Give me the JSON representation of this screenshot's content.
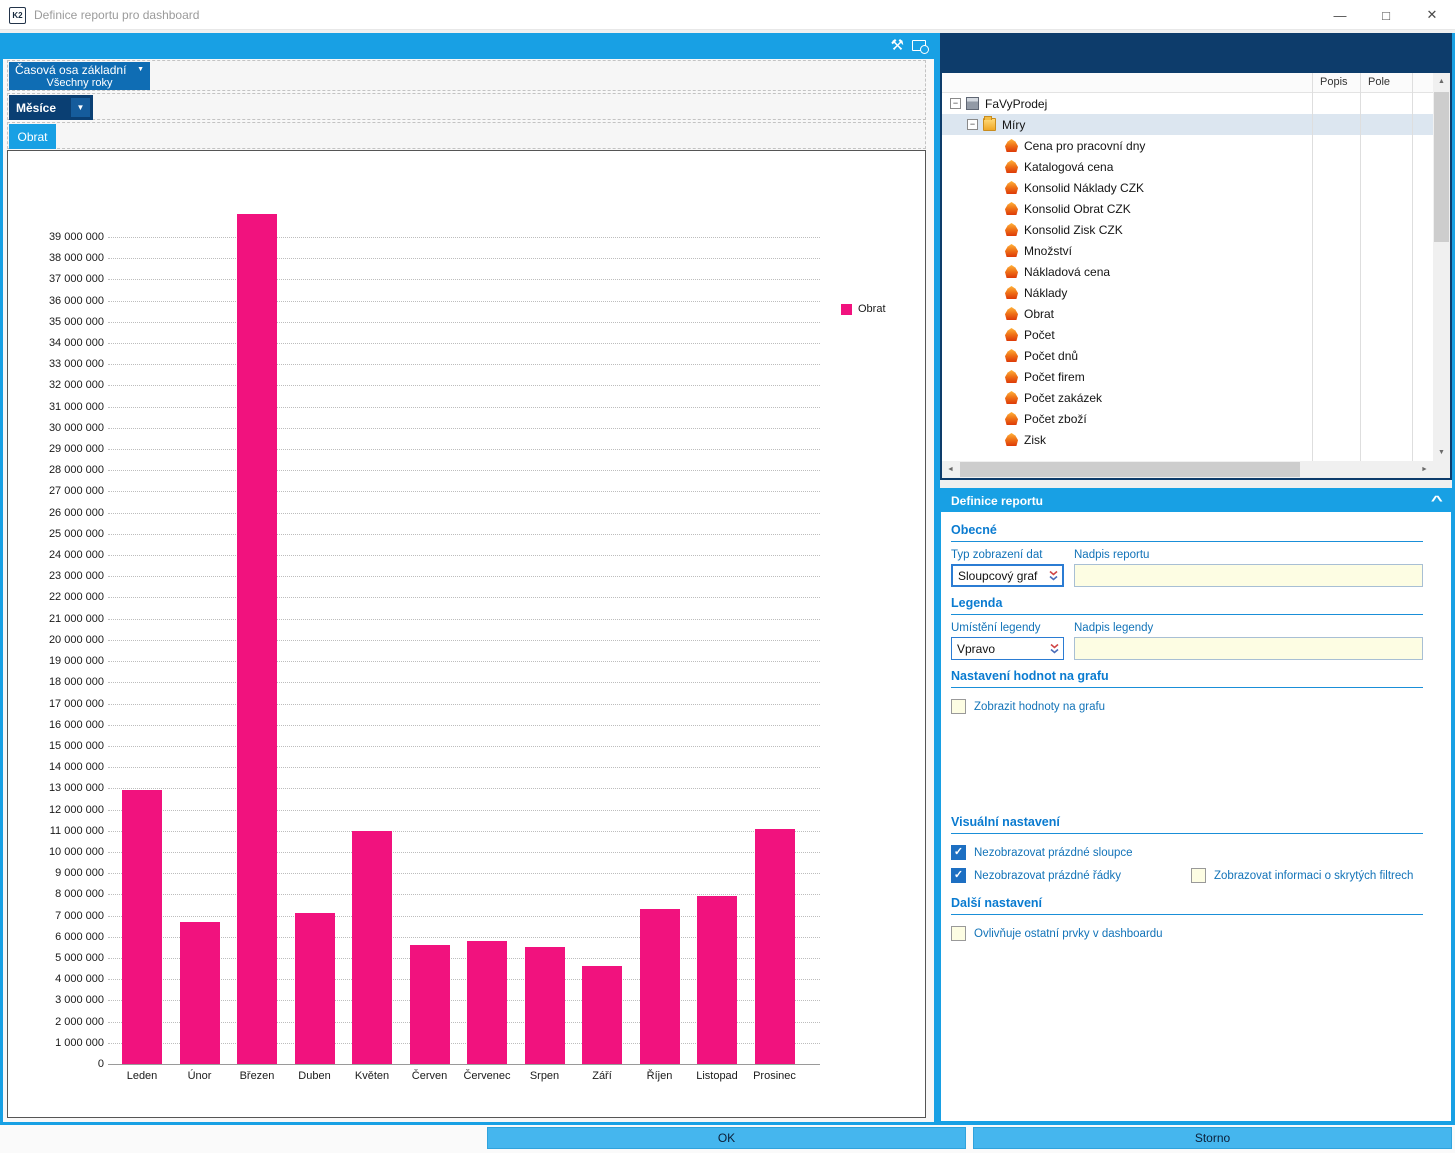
{
  "window": {
    "title": "Definice reportu pro dashboard",
    "app_icon": "K2"
  },
  "icons": {
    "minimize": "—",
    "maximize": "□",
    "close": "✕",
    "customize": "⚒",
    "triangle_down": "▼",
    "chevron_up": "^",
    "scroll_up": "▲",
    "scroll_down": "▼",
    "scroll_left": "◄",
    "scroll_right": "►",
    "check": "✓",
    "collapse_minus": "−"
  },
  "left_panel": {
    "time_axis_button": "Časová osa základní",
    "time_axis_value": "Všechny roky",
    "axis_button": "Měsíce",
    "measure_tab": "Obrat"
  },
  "chart_data": {
    "type": "bar",
    "title": "",
    "categories": [
      "Leden",
      "Únor",
      "Březen",
      "Duben",
      "Květen",
      "Červen",
      "Červenec",
      "Srpen",
      "Září",
      "Říjen",
      "Listopad",
      "Prosinec"
    ],
    "series": [
      {
        "name": "Obrat",
        "color": "#f1127e",
        "values": [
          12900000,
          6700000,
          40100000,
          7100000,
          11000000,
          5600000,
          5800000,
          5500000,
          4600000,
          7300000,
          7900000,
          11100000
        ]
      }
    ],
    "ylim": [
      0,
      39000000
    ],
    "y_tick_step": 1000000,
    "legend_position": "right",
    "grid": "horizontal-dotted"
  },
  "tree_panel": {
    "columns": {
      "popis": "Popis",
      "pole": "Pole"
    },
    "root": "FaVyProdej",
    "group": "Míry",
    "selected": "Míry",
    "items": [
      "Cena pro pracovní dny",
      "Katalogová cena",
      "Konsolid Náklady CZK",
      "Konsolid Obrat CZK",
      "Konsolid Zisk CZK",
      "Množství",
      "Nákladová cena",
      "Náklady",
      "Obrat",
      "Počet",
      "Počet dnů",
      "Počet firem",
      "Počet zakázek",
      "Počet zboží",
      "Zisk"
    ]
  },
  "report_panel": {
    "header": "Definice reportu",
    "obecne": {
      "title": "Obecné",
      "typ_label": "Typ zobrazení dat",
      "typ_value": "Sloupcový graf",
      "nadpis_label": "Nadpis reportu",
      "nadpis_value": ""
    },
    "legenda": {
      "title": "Legenda",
      "umisteni_label": "Umístění legendy",
      "umisteni_value": "Vpravo",
      "nadpis_label": "Nadpis legendy",
      "nadpis_value": ""
    },
    "hodnoty": {
      "title": "Nastavení hodnot na grafu",
      "checkboxes": [
        {
          "label": "Zobrazit hodnoty na grafu",
          "checked": false
        }
      ]
    },
    "visualni": {
      "title": "Visuální nastavení",
      "checkboxes": [
        {
          "label": "Nezobrazovat prázdné sloupce",
          "checked": true
        },
        {
          "label": "Nezobrazovat prázdné řádky",
          "checked": true
        },
        {
          "label": "Zobrazovat informaci o skrytých filtrech",
          "checked": false
        }
      ]
    },
    "dalsi": {
      "title": "Další nastavení",
      "checkboxes": [
        {
          "label": "Ovlivňuje ostatní prvky v dashboardu",
          "checked": false
        }
      ]
    }
  },
  "footer": {
    "ok": "OK",
    "storno": "Storno"
  },
  "colors": {
    "accent_blue": "#18a0e4",
    "navy": "#0d3c6b",
    "bar_pink": "#f1127e",
    "button_blue": "#0f6db4",
    "dark_button": "#0a3f73",
    "input_bg": "#fdfde3",
    "heading_blue": "#0a7bd0",
    "label_blue": "#1273b8",
    "checkbox_blue": "#1d6fc2",
    "footer_button": "#45b6ee"
  }
}
